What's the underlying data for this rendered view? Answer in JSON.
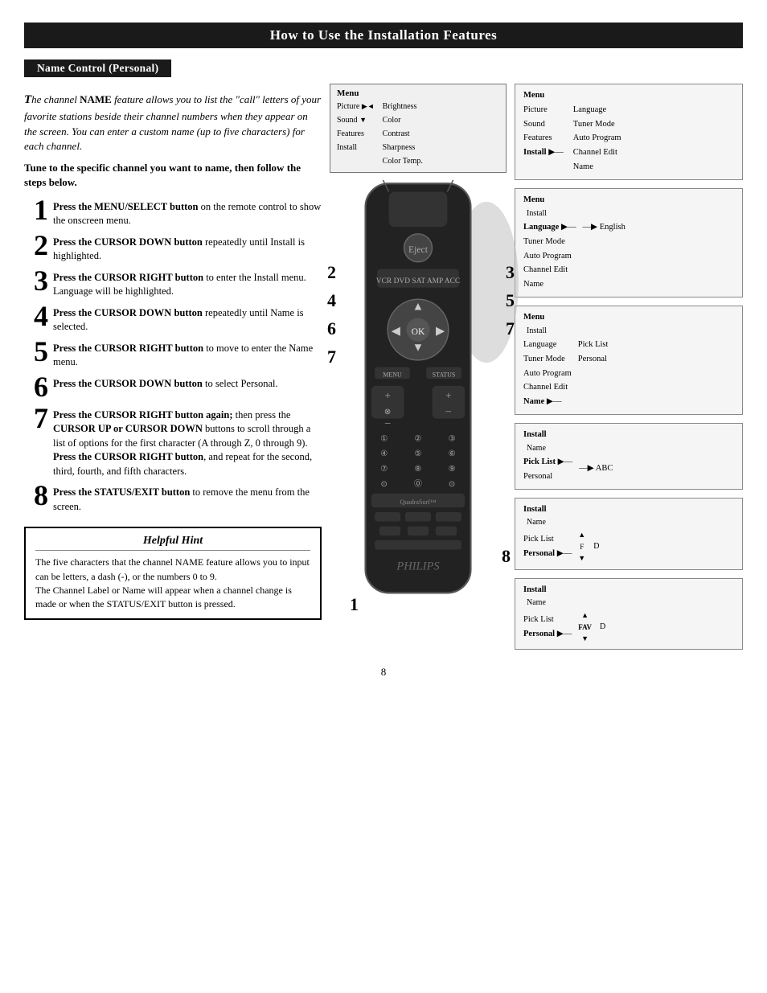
{
  "header": {
    "title": "How to Use the Installation Features"
  },
  "section_title": "Name Control (Personal)",
  "intro": {
    "text": "The channel NAME feature allows you to list the \"call\" letters of your favorite stations beside their channel numbers when they appear on the screen.  You can  enter a custom name (up to five characters) for each channel.",
    "instruction": "Tune to the specific channel you want to name, then follow the steps below."
  },
  "steps": [
    {
      "number": "1",
      "text": "Press the MENU/SELECT button on the remote control to show the onscreen menu."
    },
    {
      "number": "2",
      "text": "Press the CURSOR DOWN button repeatedly until Install is highlighted."
    },
    {
      "number": "3",
      "text": "Press the CURSOR RIGHT button to enter the Install menu. Language will be highlighted."
    },
    {
      "number": "4",
      "text": "Press the CURSOR DOWN button repeatedly until Name is selected."
    },
    {
      "number": "5",
      "text": "Press the CURSOR RIGHT button to move to enter the Name menu."
    },
    {
      "number": "6",
      "text": "Press the CURSOR DOWN button to select Personal."
    },
    {
      "number": "7",
      "text": "Press the CURSOR RIGHT button again; then press the CURSOR UP or CURSOR DOWN buttons to scroll through a list of options for the first character (A through Z, 0 through 9).  Press the CURSOR RIGHT button, and repeat for the second, third, fourth, and fifth characters."
    },
    {
      "number": "8",
      "text": "Press the STATUS/EXIT button to remove the menu from the screen."
    }
  ],
  "top_menu_diagram": {
    "title": "Menu",
    "left_items": [
      "Picture",
      "Sound",
      "Features",
      "Install"
    ],
    "right_items": [
      "Brightness",
      "Color",
      "Contrast",
      "Sharpness",
      "Color Temp."
    ]
  },
  "right_menus": [
    {
      "id": "menu1",
      "top_label": "Menu",
      "left_items": [
        "Picture",
        "Sound",
        "Features",
        "Install"
      ],
      "arrow_item": "Install",
      "right_items": [
        "Language",
        "Tuner Mode",
        "Auto Program",
        "Channel Edit",
        "Name"
      ]
    },
    {
      "id": "menu2",
      "top_label": "Menu",
      "sub_label": "Install",
      "left_items": [
        "Language",
        "Tuner Mode",
        "Auto Program",
        "Channel Edit",
        "Name"
      ],
      "arrow_item": "Language",
      "arrow_value": "English"
    },
    {
      "id": "menu3",
      "top_label": "Menu",
      "sub_label": "Install",
      "left_items": [
        "Language",
        "Tuner Mode",
        "Auto Program",
        "Channel Edit",
        "Name"
      ],
      "arrow_item": "Name",
      "right_items": [
        "Pick List",
        "Personal"
      ]
    },
    {
      "id": "menu4",
      "top_label": "Install",
      "sub_label": "Name",
      "left_items": [
        "Pick List",
        "Personal"
      ],
      "arrow_item": "Pick List",
      "arrow_value": "ABC"
    },
    {
      "id": "menu5",
      "top_label": "Install",
      "sub_label": "Name",
      "left_items": [
        "Pick List",
        "Personal"
      ],
      "arrow_item": "Personal",
      "arrow_value": "F",
      "extra": "D"
    },
    {
      "id": "menu6",
      "top_label": "Install",
      "sub_label": "Name",
      "left_items": [
        "Pick List",
        "Personal"
      ],
      "arrow_item": "Personal",
      "arrow_value": "FAV",
      "extra": "D"
    }
  ],
  "hint": {
    "title": "Helpful Hint",
    "text": "The five characters that the channel NAME feature allows you to input can be letters, a dash (-), or the numbers 0 to 9.\nThe Channel Label or Name will appear when a channel change is made or when the STATUS/EXIT button is pressed."
  },
  "page_number": "8",
  "remote_step_labels": {
    "step1": "1",
    "step2": "2",
    "step3": "3",
    "step4": "4",
    "step5": "5",
    "step6": "6",
    "step7": "7",
    "step8": "8"
  }
}
